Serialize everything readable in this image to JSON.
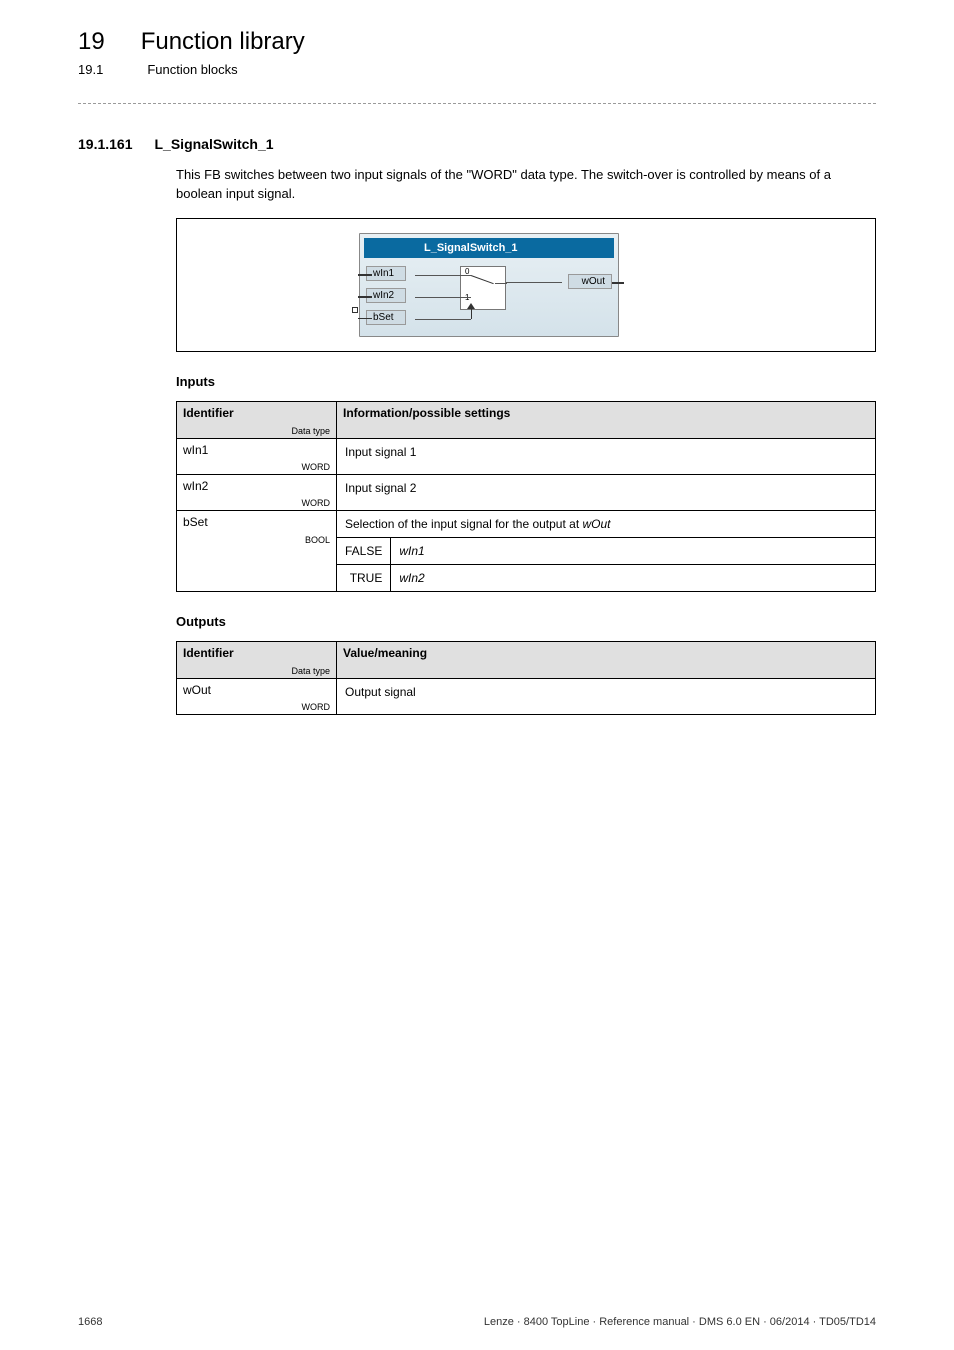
{
  "header": {
    "chapter_num": "19",
    "chapter_title": "Function library",
    "sub_num": "19.1",
    "sub_title": "Function blocks"
  },
  "section": {
    "num": "19.1.161",
    "title": "L_SignalSwitch_1"
  },
  "body": {
    "intro": "This FB switches between two input signals of the \"WORD\" data type. The switch-over is controlled by means of a boolean input signal."
  },
  "fb": {
    "title": "L_SignalSwitch_1",
    "in1": "wIn1",
    "in2": "wIn2",
    "in3": "bSet",
    "out": "wOut",
    "sw0": "0",
    "sw1": "1"
  },
  "inputs_heading": "Inputs",
  "inputs_table": {
    "head_id": "Identifier",
    "head_id_sub": "Data type",
    "head_info": "Information/possible settings",
    "rows": [
      {
        "id": "wIn1",
        "type": "WORD",
        "info": "Input signal 1"
      },
      {
        "id": "wIn2",
        "type": "WORD",
        "info": "Input signal 2"
      }
    ],
    "bset": {
      "id": "bSet",
      "type": "BOOL",
      "info": "Selection of the input signal for the output at ",
      "info_em": "wOut",
      "false_key": "FALSE",
      "false_val": "wIn1",
      "true_key": "TRUE",
      "true_val": "wIn2"
    }
  },
  "outputs_heading": "Outputs",
  "outputs_table": {
    "head_id": "Identifier",
    "head_id_sub": "Data type",
    "head_info": "Value/meaning",
    "rows": [
      {
        "id": "wOut",
        "type": "WORD",
        "info": "Output signal"
      }
    ]
  },
  "footer": {
    "left": "1668",
    "right": "Lenze · 8400 TopLine · Reference manual · DMS 6.0 EN · 06/2014 · TD05/TD14"
  }
}
